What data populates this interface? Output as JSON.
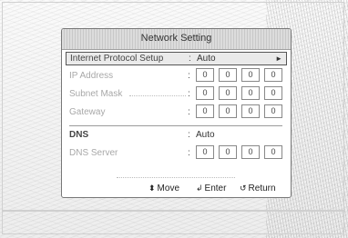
{
  "dialog": {
    "title": "Network Setting",
    "rows": [
      {
        "label": "Internet Protocol Setup",
        "value": "Auto"
      },
      {
        "label": "IP Address",
        "fields": [
          "0",
          "0",
          "0",
          "0"
        ]
      },
      {
        "label": "Subnet Mask",
        "fields": [
          "0",
          "0",
          "0",
          "0"
        ]
      },
      {
        "label": "Gateway",
        "fields": [
          "0",
          "0",
          "0",
          "0"
        ]
      },
      {
        "label": "DNS",
        "value": "Auto"
      },
      {
        "label": "DNS Server",
        "fields": [
          "0",
          "0",
          "0",
          "0"
        ]
      }
    ],
    "colon": ":",
    "hints": {
      "move": "Move",
      "enter": "Enter",
      "return": "Return"
    }
  },
  "icons": {
    "right_arrow": "right-triangle-icon",
    "move": "up-down-arrows-icon",
    "enter": "enter-icon",
    "return": "return-icon"
  }
}
